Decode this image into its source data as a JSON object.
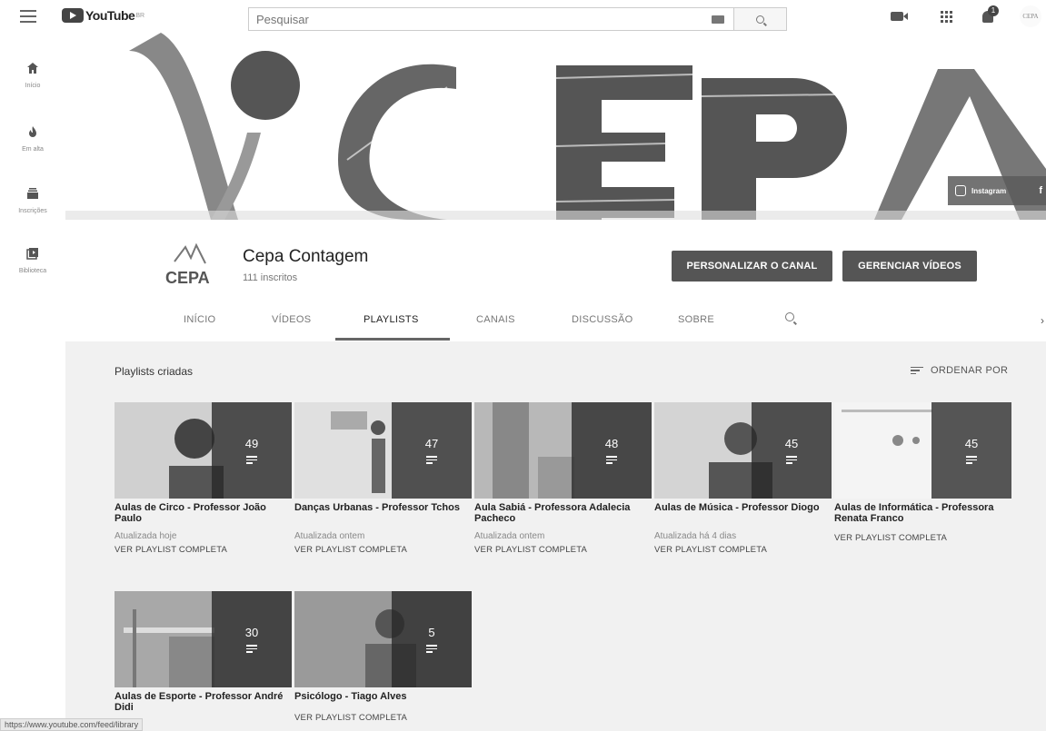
{
  "topbar": {
    "logo_text": "YouTube",
    "logo_region": "BR",
    "search_placeholder": "Pesquisar",
    "notification_count": "1",
    "account_avatar_text": "CEPA"
  },
  "sidenav": {
    "items": [
      {
        "label": "Início",
        "icon": "home-icon"
      },
      {
        "label": "Em alta",
        "icon": "flame-icon"
      },
      {
        "label": "Inscrições",
        "icon": "subscriptions-icon"
      },
      {
        "label": "Biblioteca",
        "icon": "library-icon"
      }
    ]
  },
  "banner": {
    "letters": "YCEPA",
    "social_label": "Instagram",
    "social_extra": "f"
  },
  "channel": {
    "avatar_text": "CEPA",
    "name": "Cepa Contagem",
    "subscribers": "111 inscritos",
    "customize_label": "PERSONALIZAR O CANAL",
    "manage_label": "GERENCIAR VÍDEOS"
  },
  "tabs": [
    {
      "label": "INÍCIO"
    },
    {
      "label": "VÍDEOS"
    },
    {
      "label": "PLAYLISTS"
    },
    {
      "label": "CANAIS"
    },
    {
      "label": "DISCUSSÃO"
    },
    {
      "label": "SOBRE"
    }
  ],
  "content": {
    "section_title": "Playlists criadas",
    "sort_label": "ORDENAR POR"
  },
  "playlists": [
    {
      "title": "Aulas de Circo - Professor João Paulo",
      "count": "49",
      "updated": "Atualizada hoje",
      "link": "VER PLAYLIST COMPLETA"
    },
    {
      "title": "Danças Urbanas - Professor Tchos",
      "count": "47",
      "updated": "Atualizada ontem",
      "link": "VER PLAYLIST COMPLETA"
    },
    {
      "title": "Aula Sabiá - Professora Adalecia Pacheco",
      "count": "48",
      "updated": "Atualizada ontem",
      "link": "VER PLAYLIST COMPLETA"
    },
    {
      "title": "Aulas de Música - Professor Diogo",
      "count": "45",
      "updated": "Atualizada há 4 dias",
      "link": "VER PLAYLIST COMPLETA"
    },
    {
      "title": "Aulas de Informática - Professora Renata Franco",
      "count": "45",
      "updated": "",
      "link": "VER PLAYLIST COMPLETA"
    },
    {
      "title": "Aulas de Esporte - Professor André Didi",
      "count": "30",
      "updated": "",
      "link": ""
    },
    {
      "title": "Psicólogo - Tiago Alves",
      "count": "5",
      "updated": "",
      "link": "VER PLAYLIST COMPLETA"
    }
  ],
  "status_bar": {
    "url": "https://www.youtube.com/feed/library"
  }
}
